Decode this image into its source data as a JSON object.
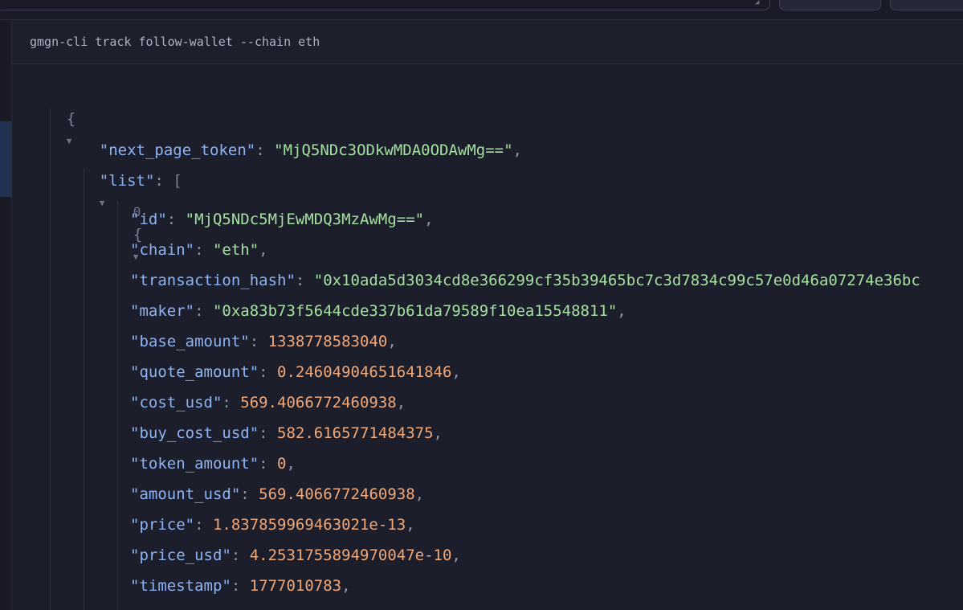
{
  "topbar": {
    "button_1_label": "",
    "button_2_label": ""
  },
  "command": "gmgn-cli track follow-wallet --chain eth",
  "json_view": {
    "root_open": "{",
    "next_page_token": {
      "key": "\"next_page_token\"",
      "value": "\"MjQ5NDc3ODkwMDA0ODAwMg==\""
    },
    "list": {
      "key": "\"list\"",
      "open": "["
    },
    "item_index": "0",
    "item_open": "{",
    "rows": [
      {
        "key": "\"id\"",
        "value": "\"MjQ5NDc5MjEwMDQ3MzAwMg==\"",
        "type": "string"
      },
      {
        "key": "\"chain\"",
        "value": "\"eth\"",
        "type": "string"
      },
      {
        "key": "\"transaction_hash\"",
        "value": "\"0x10ada5d3034cd8e366299cf35b39465bc7c3d7834c99c57e0d46a07274e36bc",
        "type": "string"
      },
      {
        "key": "\"maker\"",
        "value": "\"0xa83b73f5644cde337b61da79589f10ea15548811\"",
        "type": "string"
      },
      {
        "key": "\"base_amount\"",
        "value": "1338778583040",
        "type": "number"
      },
      {
        "key": "\"quote_amount\"",
        "value": "0.24604904651641846",
        "type": "number"
      },
      {
        "key": "\"cost_usd\"",
        "value": "569.4066772460938",
        "type": "number"
      },
      {
        "key": "\"buy_cost_usd\"",
        "value": "582.6165771484375",
        "type": "number"
      },
      {
        "key": "\"token_amount\"",
        "value": "0",
        "type": "number"
      },
      {
        "key": "\"amount_usd\"",
        "value": "569.4066772460938",
        "type": "number"
      },
      {
        "key": "\"price\"",
        "value": "1.837859969463021e-13",
        "type": "number"
      },
      {
        "key": "\"price_usd\"",
        "value": "4.2531755894970047e-10",
        "type": "number"
      },
      {
        "key": "\"timestamp\"",
        "value": "1777010783",
        "type": "number"
      }
    ]
  }
}
